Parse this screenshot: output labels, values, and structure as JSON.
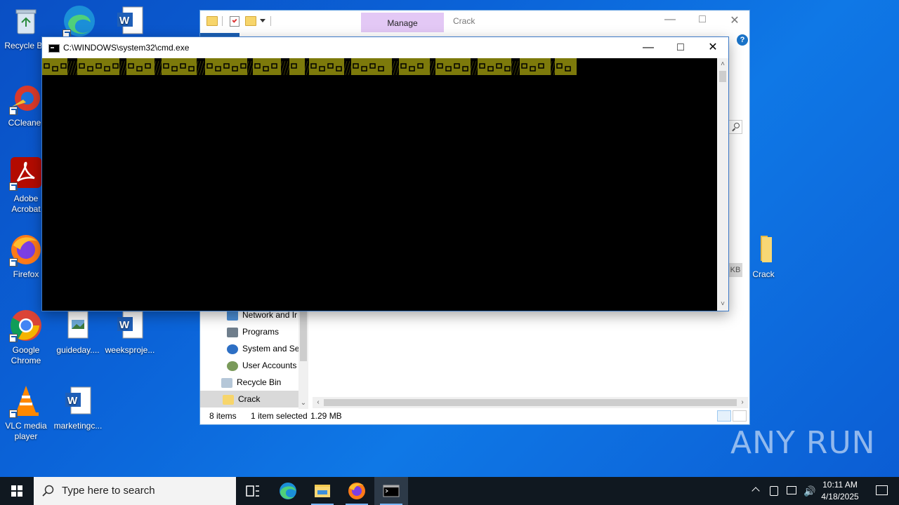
{
  "desktop": {
    "icons": [
      {
        "label": "Recycle Bin"
      },
      {
        "label": "CCleaner"
      },
      {
        "label": "Adobe Acrobat"
      },
      {
        "label": "Firefox"
      },
      {
        "label": "Google Chrome"
      },
      {
        "label": "VLC media player"
      },
      {
        "label": "guideday...."
      },
      {
        "label": "weeksproje..."
      },
      {
        "label": "marketingc..."
      },
      {
        "label": "Crack"
      }
    ]
  },
  "explorer": {
    "ribbon_tab": "Manage",
    "title": "Crack",
    "size_fragment": "KB",
    "nav_items": [
      {
        "label": "Network and Ir"
      },
      {
        "label": "Programs"
      },
      {
        "label": "System and Sec"
      },
      {
        "label": "User Accounts"
      },
      {
        "label": "Recycle Bin"
      },
      {
        "label": "Crack"
      }
    ],
    "status": {
      "items": "8 items",
      "selected": "1 item selected",
      "size": "1.29 MB"
    }
  },
  "cmd": {
    "title": "C:\\WINDOWS\\system32\\cmd.exe",
    "banner_color": "#7d7a0b"
  },
  "taskbar": {
    "search_placeholder": "Type here to search",
    "time": "10:11 AM",
    "date": "4/18/2025"
  },
  "watermark": "ANY RUN"
}
